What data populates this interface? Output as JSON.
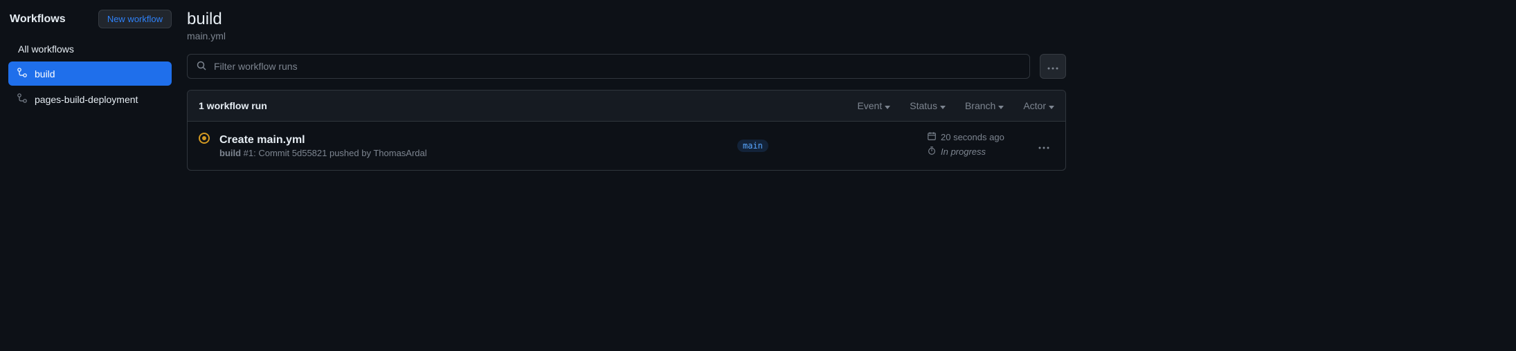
{
  "sidebar": {
    "title": "Workflows",
    "new_workflow_label": "New workflow",
    "all_workflows_label": "All workflows",
    "items": [
      {
        "label": "build",
        "active": true
      },
      {
        "label": "pages-build-deployment",
        "active": false
      }
    ]
  },
  "header": {
    "title": "build",
    "subtitle": "main.yml"
  },
  "filter": {
    "placeholder": "Filter workflow runs"
  },
  "runs": {
    "count_label": "1 workflow run",
    "filters": {
      "event": "Event",
      "status": "Status",
      "branch": "Branch",
      "actor": "Actor"
    },
    "items": [
      {
        "title": "Create main.yml",
        "workflow_name": "build",
        "run_number": "#1",
        "description": ": Commit 5d55821 pushed by ThomasArdal",
        "branch": "main",
        "time_ago": "20 seconds ago",
        "duration": "In progress"
      }
    ]
  }
}
